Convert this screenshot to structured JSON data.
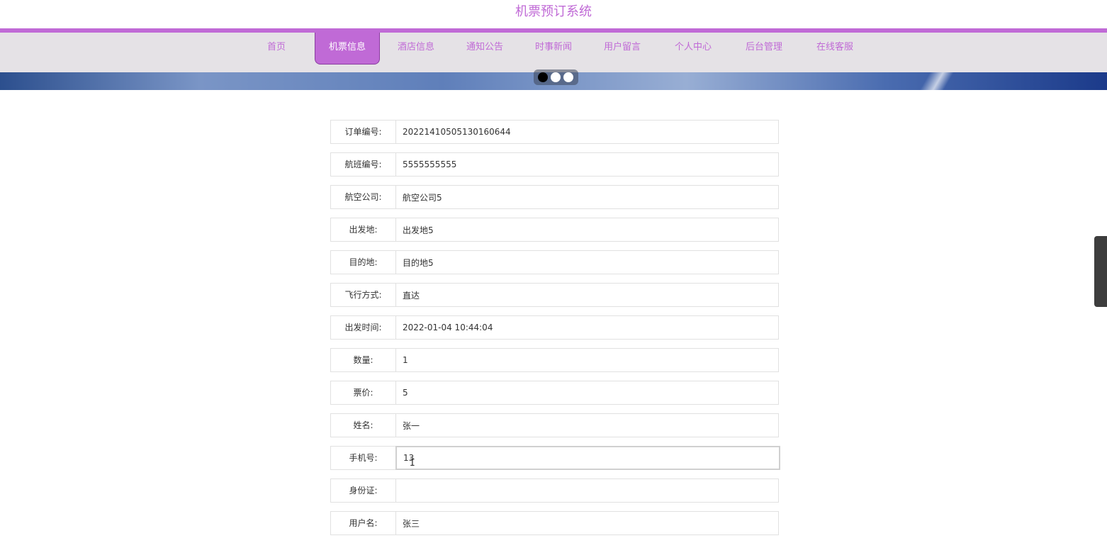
{
  "site": {
    "title": "机票预订系统"
  },
  "colors": {
    "accent": "#c06ad6",
    "nav_bg": "#e5e2e6"
  },
  "nav": {
    "items": [
      {
        "label": "首页"
      },
      {
        "label": "机票信息",
        "active": true
      },
      {
        "label": "酒店信息"
      },
      {
        "label": "通知公告"
      },
      {
        "label": "时事新闻"
      },
      {
        "label": "用户留言"
      },
      {
        "label": "个人中心"
      },
      {
        "label": "后台管理"
      },
      {
        "label": "在线客服"
      }
    ]
  },
  "carousel": {
    "dot_count": 3,
    "active_index": 0
  },
  "form": {
    "fields": [
      {
        "label": "订单编号:",
        "value": "20221410505130160644"
      },
      {
        "label": "航班编号:",
        "value": "5555555555"
      },
      {
        "label": "航空公司:",
        "value": "航空公司5"
      },
      {
        "label": "出发地:",
        "value": "出发地5"
      },
      {
        "label": "目的地:",
        "value": "目的地5"
      },
      {
        "label": "飞行方式:",
        "value": "直达"
      },
      {
        "label": "出发时间:",
        "value": "2022-01-04 10:44:04"
      },
      {
        "label": "数量:",
        "value": "1"
      },
      {
        "label": "票价:",
        "value": "5"
      },
      {
        "label": "姓名:",
        "value": "张一"
      },
      {
        "label": "手机号:",
        "value": "13"
      },
      {
        "label": "身份证:",
        "value": ""
      },
      {
        "label": "用户名:",
        "value": "张三"
      }
    ]
  }
}
